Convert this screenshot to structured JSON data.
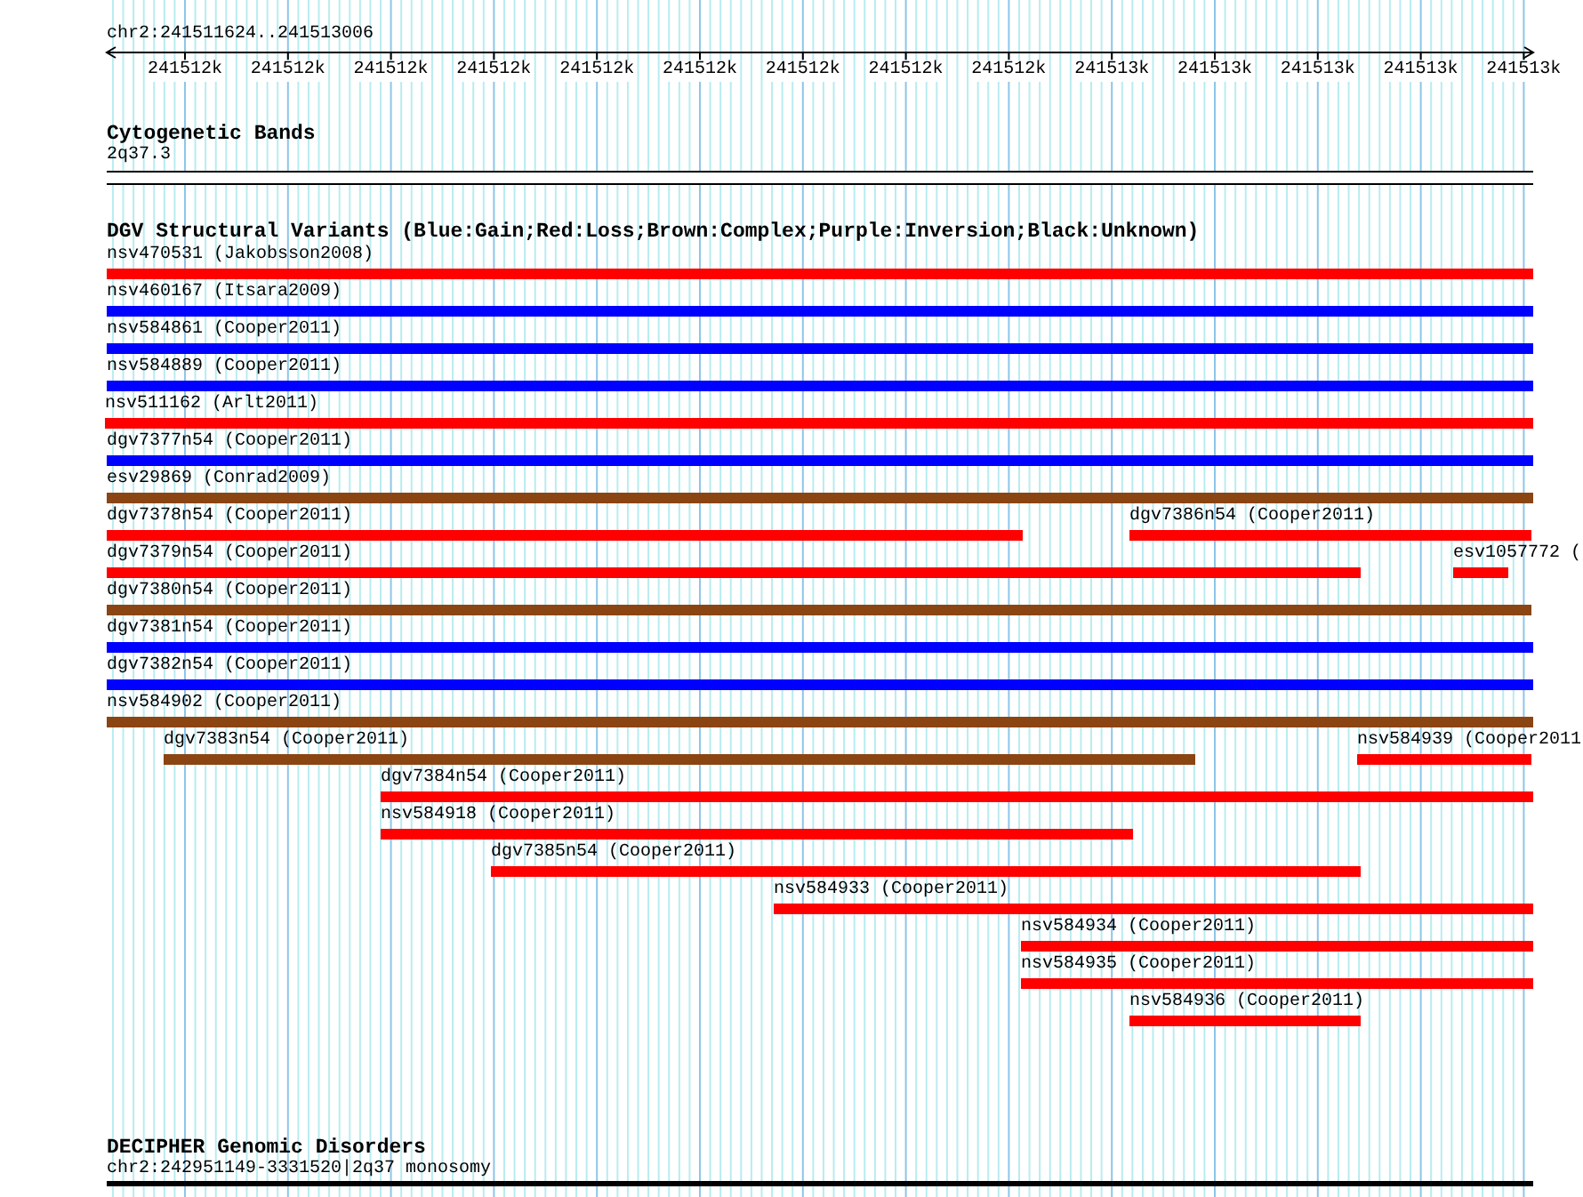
{
  "ruler": {
    "location": "chr2:241511624..241513006",
    "ticks": [
      "241512k",
      "241512k",
      "241512k",
      "241512k",
      "241512k",
      "241512k",
      "241512k",
      "241512k",
      "241512k",
      "241513k",
      "241513k",
      "241513k",
      "241513k",
      "241513k"
    ]
  },
  "tracks": [
    {
      "kind": "cytoband",
      "title": "Cytogenetic Bands",
      "features": [
        {
          "label": "2q37.3"
        }
      ]
    },
    {
      "kind": "variants",
      "title": "DGV Structural Variants (Blue:Gain;Red:Loss;Brown:Complex;Purple:Inversion;Black:Unknown)",
      "rows": [
        {
          "features": [
            {
              "label": "nsv470531 (Jakobsson2008)",
              "color": "#ff0000"
            }
          ]
        },
        {
          "features": [
            {
              "label": "nsv460167 (Itsara2009)",
              "color": "#0000ff"
            }
          ]
        },
        {
          "features": [
            {
              "label": "nsv584861 (Cooper2011)",
              "color": "#0000ff"
            }
          ]
        },
        {
          "features": [
            {
              "label": "nsv584889 (Cooper2011)",
              "color": "#0000ff"
            }
          ]
        },
        {
          "features": [
            {
              "label": "nsv511162 (Arlt2011)",
              "color": "#ff0000"
            }
          ]
        },
        {
          "features": [
            {
              "label": "dgv7377n54 (Cooper2011)",
              "color": "#0000ff"
            }
          ]
        },
        {
          "features": [
            {
              "label": "esv29869 (Conrad2009)",
              "color": "#8b4513"
            }
          ]
        },
        {
          "features": [
            {
              "label": "dgv7378n54 (Cooper2011)",
              "color": "#ff0000"
            },
            {
              "label": "dgv7386n54 (Cooper2011)",
              "color": "#ff0000"
            }
          ]
        },
        {
          "features": [
            {
              "label": "dgv7379n54 (Cooper2011)",
              "color": "#ff0000"
            },
            {
              "label": "esv1057772 (",
              "color": "#ff0000"
            }
          ]
        },
        {
          "features": [
            {
              "label": "dgv7380n54 (Cooper2011)",
              "color": "#8b4513"
            }
          ]
        },
        {
          "features": [
            {
              "label": "dgv7381n54 (Cooper2011)",
              "color": "#0000ff"
            }
          ]
        },
        {
          "features": [
            {
              "label": "dgv7382n54 (Cooper2011)",
              "color": "#0000ff"
            }
          ]
        },
        {
          "features": [
            {
              "label": "nsv584902 (Cooper2011)",
              "color": "#8b4513"
            }
          ]
        },
        {
          "features": [
            {
              "label": "dgv7383n54 (Cooper2011)",
              "color": "#8b4513"
            },
            {
              "label": "nsv584939 (Cooper2011",
              "color": "#ff0000"
            }
          ]
        },
        {
          "features": [
            {
              "label": "dgv7384n54 (Cooper2011)",
              "color": "#ff0000"
            }
          ]
        },
        {
          "features": [
            {
              "label": "nsv584918 (Cooper2011)",
              "color": "#ff0000"
            }
          ]
        },
        {
          "features": [
            {
              "label": "dgv7385n54 (Cooper2011)",
              "color": "#ff0000"
            }
          ]
        },
        {
          "features": [
            {
              "label": "nsv584933 (Cooper2011)",
              "color": "#ff0000"
            }
          ]
        },
        {
          "features": [
            {
              "label": "nsv584934 (Cooper2011)",
              "color": "#ff0000"
            }
          ]
        },
        {
          "features": [
            {
              "label": "nsv584935 (Cooper2011)",
              "color": "#ff0000"
            }
          ]
        },
        {
          "features": [
            {
              "label": "nsv584936 (Cooper2011)",
              "color": "#ff0000"
            }
          ]
        }
      ]
    },
    {
      "kind": "decipher",
      "title": "DECIPHER Genomic Disorders",
      "features": [
        {
          "label": "chr2:242951149-3331520|2q37 monosomy"
        }
      ]
    }
  ]
}
